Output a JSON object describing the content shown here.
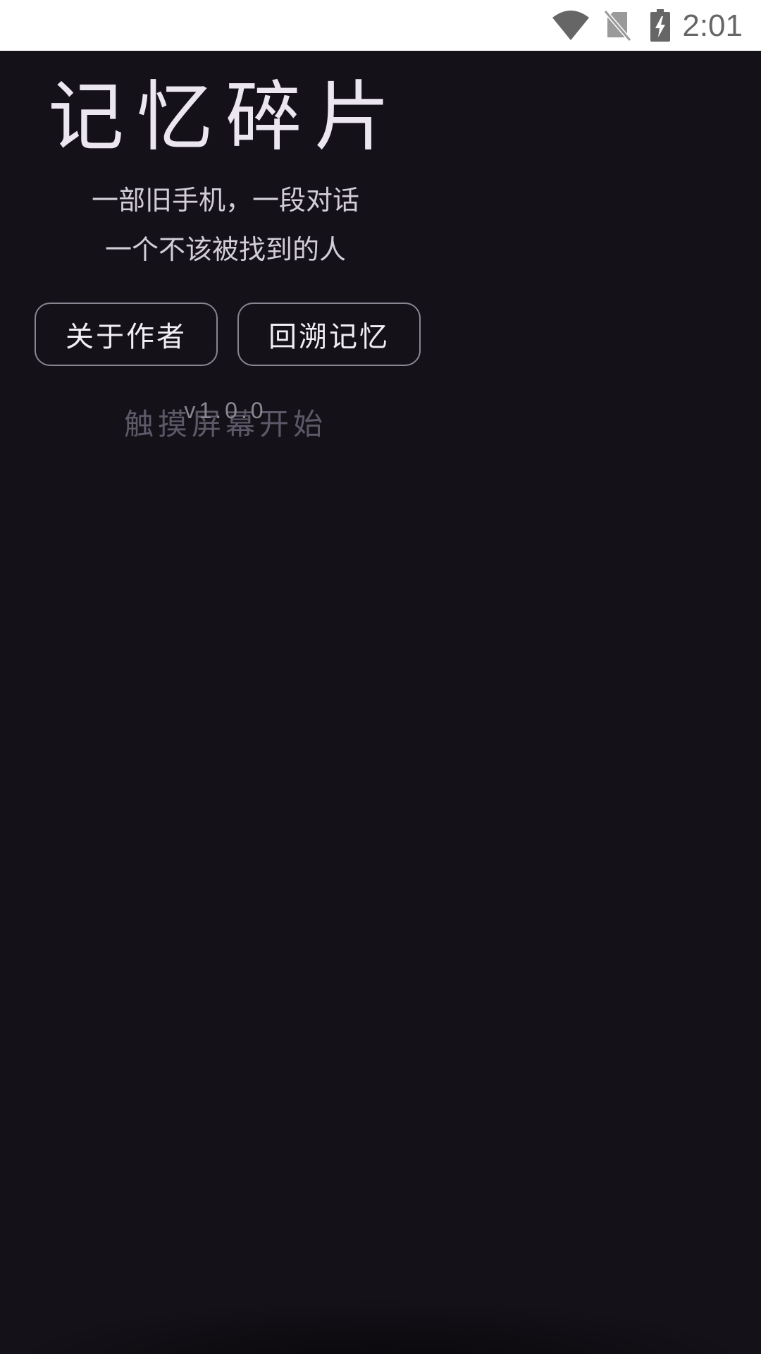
{
  "status_bar": {
    "time": "2:01",
    "icons": [
      "wifi-icon",
      "no-sim-icon",
      "battery-charging-icon"
    ],
    "icon_color": "#666666"
  },
  "app": {
    "background": "#141118",
    "title": "记忆碎片",
    "subtitle_line1": "一部旧手机，一段对话",
    "subtitle_line2": "一个不该被找到的人",
    "buttons": {
      "about": "关于作者",
      "recall": "回溯记忆"
    },
    "hint": "触摸屏幕开始",
    "version": "v1.0.0"
  }
}
